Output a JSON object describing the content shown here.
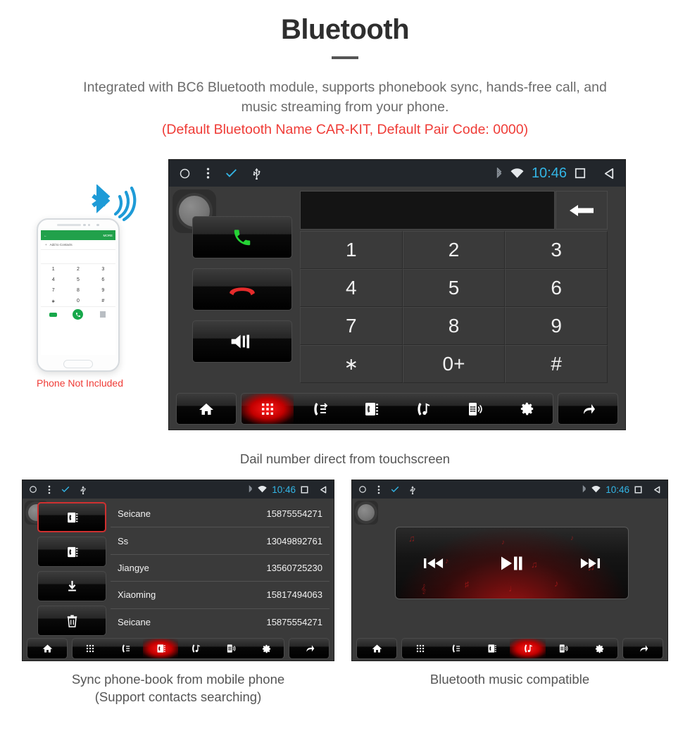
{
  "header": {
    "title": "Bluetooth",
    "subtitle_line1": "Integrated with BC6 Bluetooth module, supports phonebook sync, hands-free call, and",
    "subtitle_line2": "music streaming from your phone.",
    "note": "(Default Bluetooth Name CAR-KIT, Default Pair Code: 0000)",
    "note_color": "#ef3b36"
  },
  "phone_mockup": {
    "appbar_back": "←",
    "appbar_more": "MORE",
    "add_to_contacts": "Add to Contacts",
    "keys": [
      "1",
      "2",
      "3",
      "4",
      "5",
      "6",
      "7",
      "8",
      "9",
      "∗",
      "0",
      "#"
    ],
    "caption": "Phone Not Included",
    "caption_color": "#ef3b36",
    "bluetooth_color": "#1e9bd7"
  },
  "statusbar": {
    "time": "10:46",
    "time_color": "#33b5e5",
    "background": "#22262b"
  },
  "dialer_screen": {
    "number_value": "",
    "number_placeholder": "",
    "keys": [
      "1",
      "2",
      "3",
      "4",
      "5",
      "6",
      "7",
      "8",
      "9",
      "∗",
      "0+",
      "#"
    ],
    "call_buttons": [
      {
        "name": "answer-call",
        "color": "#25d335"
      },
      {
        "name": "end-call",
        "color": "#e52b2b"
      },
      {
        "name": "mute-speaker",
        "color": "#ffffff"
      }
    ],
    "caption": "Dail number direct from touchscreen"
  },
  "navbar": {
    "items": [
      {
        "icon": "dialpad-icon",
        "label": "Dialpad"
      },
      {
        "icon": "call-log-icon",
        "label": "Call log"
      },
      {
        "icon": "phonebook-icon",
        "label": "Phonebook"
      },
      {
        "icon": "bluetooth-music-icon",
        "label": "Bluetooth music"
      },
      {
        "icon": "device-pairing-icon",
        "label": "Device"
      },
      {
        "icon": "settings-gear-icon",
        "label": "Settings"
      }
    ],
    "home_label": "Home",
    "back_label": "Back",
    "active_color": "#c20000"
  },
  "contacts_screen": {
    "side_buttons": [
      {
        "icon": "phonebook-icon",
        "label": "Phone contacts",
        "selected": true
      },
      {
        "icon": "sim-contacts-icon",
        "label": "SIM contacts",
        "selected": false
      },
      {
        "icon": "download-icon",
        "label": "Download contacts",
        "selected": false
      },
      {
        "icon": "trash-icon",
        "label": "Delete contacts",
        "selected": false
      }
    ],
    "rows": [
      {
        "name": "Seicane",
        "number": "15875554271"
      },
      {
        "name": "Ss",
        "number": "13049892761"
      },
      {
        "name": "Jiangye",
        "number": "13560725230"
      },
      {
        "name": "Xiaoming",
        "number": "15817494063"
      },
      {
        "name": "Seicane",
        "number": "15875554271"
      }
    ],
    "active_nav_index": 2,
    "caption_line1": "Sync phone-book from mobile phone",
    "caption_line2": "(Support contacts searching)"
  },
  "music_screen": {
    "controls": [
      {
        "icon": "previous-track-icon",
        "glyph": "⏮"
      },
      {
        "icon": "play-pause-icon",
        "glyph": "▶▐▐"
      },
      {
        "icon": "next-track-icon",
        "glyph": "⏭"
      }
    ],
    "active_nav_index": 3,
    "caption": "Bluetooth music compatible"
  }
}
